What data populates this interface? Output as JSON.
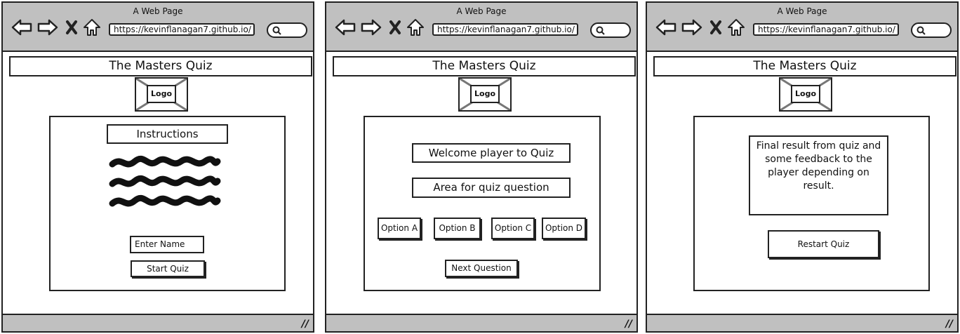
{
  "browser": {
    "title": "A Web Page",
    "url": "https://kevinflanagan7.github.io/"
  },
  "site": {
    "header": "The Masters Quiz",
    "logo": "Logo"
  },
  "screen1": {
    "instructions": "Instructions",
    "name_placeholder": "Enter Name",
    "start_button": "Start Quiz"
  },
  "screen2": {
    "welcome": "Welcome player to Quiz",
    "question": "Area for quiz question",
    "options": [
      "Option A",
      "Option B",
      "Option C",
      "Option D"
    ],
    "next_button": "Next Question"
  },
  "screen3": {
    "result": "Final result from quiz and some feedback to the player depending on result.",
    "restart_button": "Restart Quiz"
  }
}
